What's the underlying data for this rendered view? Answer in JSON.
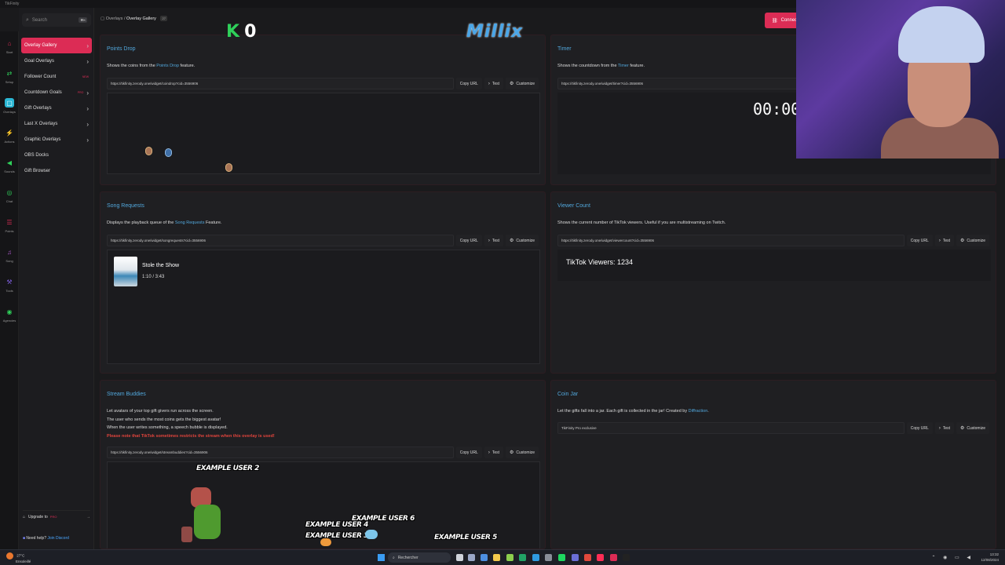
{
  "window": {
    "title": "TikFinity"
  },
  "rail": [
    {
      "icon": "home-icon",
      "glyph": "⌂",
      "label": "Start",
      "color": "#dc2c55"
    },
    {
      "icon": "setup-icon",
      "glyph": "⇄",
      "label": "Setup",
      "color": "#2fd05a"
    },
    {
      "icon": "overlays-icon",
      "glyph": "▢",
      "label": "Overlays",
      "color": "#ffffff",
      "active": true
    },
    {
      "icon": "actions-icon",
      "glyph": "⚡",
      "label": "Actions",
      "color": "#b45bd6"
    },
    {
      "icon": "sounds-icon",
      "glyph": "◀",
      "label": "Sounds",
      "color": "#2fd05a"
    },
    {
      "icon": "chat-icon",
      "glyph": "◎",
      "label": "Chat",
      "color": "#2fd05a"
    },
    {
      "icon": "points-icon",
      "glyph": "☰",
      "label": "Points",
      "color": "#dc2c55"
    },
    {
      "icon": "song-icon",
      "glyph": "♫",
      "label": "Song",
      "color": "#b45bd6"
    },
    {
      "icon": "tools-icon",
      "glyph": "⚒",
      "label": "Tools",
      "color": "#7a5bd6"
    },
    {
      "icon": "agencies-icon",
      "glyph": "◉",
      "label": "Agencies",
      "color": "#2fd05a"
    }
  ],
  "sidebar": {
    "search_placeholder": "Search",
    "search_kbd": "⌘K",
    "items": [
      {
        "label": "Overlay Gallery",
        "active": true,
        "chevron": true
      },
      {
        "label": "Goal Overlays",
        "chevron": true
      },
      {
        "label": "Follower Count",
        "badge": "NEW"
      },
      {
        "label": "Countdown Goals",
        "badge": "PRO",
        "chevron": true
      },
      {
        "label": "Gift Overlays",
        "chevron": true
      },
      {
        "label": "Last X Overlays",
        "chevron": true
      },
      {
        "label": "Graphic Overlays",
        "chevron": true
      },
      {
        "label": "OBS Docks"
      },
      {
        "label": "Gift Browser"
      }
    ],
    "upgrade_label": "Upgrade to",
    "upgrade_badge": "PRO",
    "help_label": "Need help?",
    "help_link": "Join Discord"
  },
  "topbar": {
    "crumb_parent": "Overlays",
    "crumb_current": "Overlay Gallery",
    "crumb_tag": "27",
    "connect_label": "Connect"
  },
  "stream_overlay": {
    "counter_letter": "K",
    "counter_value": "0",
    "brand": "Millix"
  },
  "cards": {
    "points_drop": {
      "title": "Points Drop",
      "desc_pre": "Shows the coins from the ",
      "desc_link": "Points Drop",
      "desc_post": " feature.",
      "url": "https://tikfinity.zerody.one/widget/coindrop?cid=3556906"
    },
    "timer": {
      "title": "Timer",
      "desc_pre": "Shows the countdown from the ",
      "desc_link": "Timer",
      "desc_post": " feature.",
      "url": "https://tikfinity.zerody.one/widget/timer?cid=3556906",
      "preview_time": "00:00"
    },
    "song_requests": {
      "title": "Song Requests",
      "desc_pre": "Displays the playback queue of the ",
      "desc_link": "Song Requests",
      "desc_post": " Feature.",
      "url": "https://tikfinity.zerody.one/widget/songrequests?cid=3556906",
      "song_title": "Stole the Show",
      "song_time": "1:10 / 3:43"
    },
    "viewer_count": {
      "title": "Viewer Count",
      "desc": "Shows the current number of TikTok viewers. Useful if you are multistreaming on Twitch.",
      "url": "https://tikfinity.zerody.one/widget/viewercount?cid=3556906",
      "preview_text": "TikTok Viewers: 1234"
    },
    "stream_buddies": {
      "title": "Stream Buddies",
      "desc1": "Let avatars of your top gift givers run across the screen.",
      "desc2": "The user who sends the most coins gets the biggest avatar!",
      "desc3": "When the user writes something, a speech bubble is displayed.",
      "warning": "Please note that TikTok sometimes restricts the stream when this overlay is used!",
      "url": "https://tikfinity.zerody.one/widget/streambuddies?cid=3556906",
      "buddy_2": "EXAMPLE USER 2",
      "buddy_4": "EXAMPLE USER 4",
      "buddy_3": "EXAMPLE USER 3",
      "buddy_6": "EXAMPLE USER 6",
      "buddy_5": "EXAMPLE USER 5"
    },
    "coin_jar": {
      "title": "Coin Jar",
      "desc_pre": "Let the gifts fall into a jar. Each gift is collected in the jar! Created by ",
      "desc_link": "Diffraction",
      "desc_post": ".",
      "url": "TikFinity Pro exclusive"
    }
  },
  "buttons": {
    "copy_url": "Copy URL",
    "test": "Test",
    "customize": "Customize"
  },
  "taskbar": {
    "weather_temp": "27°C",
    "weather_desc": "Ensoleillé",
    "search_label": "Rechercher",
    "time": "13:32",
    "date": "12/08/2024"
  }
}
